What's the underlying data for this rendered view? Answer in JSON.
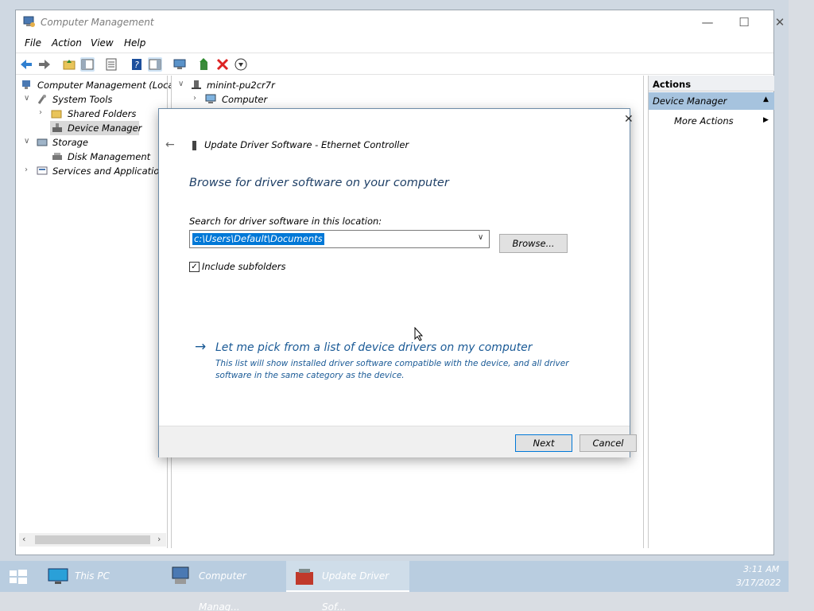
{
  "main_window": {
    "title": "Computer Management",
    "menu": [
      "File",
      "Action",
      "View",
      "Help"
    ]
  },
  "left_tree": [
    {
      "label": "Computer Management (Local)"
    },
    {
      "label": "System Tools"
    },
    {
      "label": "Shared Folders"
    },
    {
      "label": "Device Manager"
    },
    {
      "label": "Storage"
    },
    {
      "label": "Disk Management"
    },
    {
      "label": "Services and Applications"
    }
  ],
  "middle_tree": {
    "root": "minint-pu2cr7r",
    "child": "Computer"
  },
  "actions": {
    "header": "Actions",
    "selected": "Device Manager",
    "more": "More Actions"
  },
  "dialog": {
    "title": "Update Driver Software - Ethernet Controller",
    "heading": "Browse for driver software on your computer",
    "search_label": "Search for driver software in this location:",
    "path_value": "c:\\Users\\Default\\Documents",
    "browse_label": "Browse...",
    "include_subfolders": "Include subfolders",
    "include_checked": true,
    "pick_link": "Let me pick from a list of device drivers on my computer",
    "pick_desc_1": "This list will show installed driver software compatible with the device, and all driver",
    "pick_desc_2": "software in the same category as the device.",
    "next_label": "Next",
    "cancel_label": "Cancel"
  },
  "taskbar": {
    "items": [
      "This PC",
      "Computer Manag...",
      "Update Driver Sof..."
    ],
    "time": "3:11 AM",
    "date": "3/17/2022"
  },
  "colors": {
    "accent": "#0078d7",
    "link": "#1a5a96",
    "heading": "#1e3f66",
    "selected_action": "#a6c3de",
    "taskbar": "#b9cde0"
  }
}
